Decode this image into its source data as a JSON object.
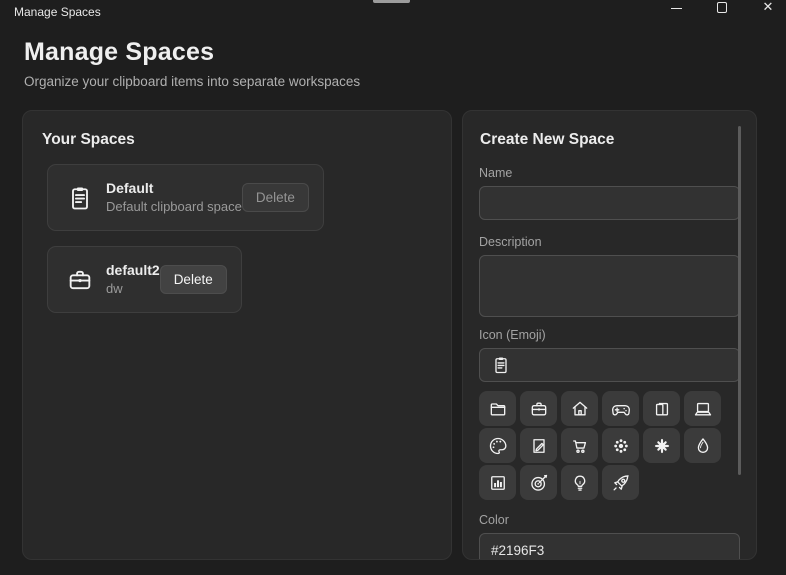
{
  "window": {
    "title": "Manage Spaces",
    "close_glyph": "✕"
  },
  "header": {
    "title": "Manage Spaces",
    "subtitle": "Organize your clipboard items into separate workspaces"
  },
  "spaces_panel": {
    "title": "Your Spaces",
    "items": [
      {
        "icon": "clipboard-icon",
        "name": "Default",
        "description": "Default clipboard space",
        "delete_label": "Delete",
        "delete_disabled": true
      },
      {
        "icon": "briefcase-icon",
        "name": "default2",
        "description": "dw",
        "delete_label": "Delete",
        "delete_disabled": false
      }
    ]
  },
  "create_panel": {
    "title": "Create New Space",
    "fields": {
      "name": {
        "label": "Name",
        "value": ""
      },
      "description": {
        "label": "Description",
        "value": ""
      },
      "icon": {
        "label": "Icon (Emoji)",
        "value": "clipboard-icon"
      },
      "color": {
        "label": "Color",
        "value": "#2196F3"
      }
    },
    "emoji_options": [
      "folder-icon",
      "briefcase-icon",
      "house-icon",
      "gamepad-icon",
      "books-icon",
      "laptop-icon",
      "palette-icon",
      "memo-icon",
      "cart-icon",
      "gear-icon",
      "sparkle-icon",
      "droplet-icon",
      "chart-icon",
      "target-icon",
      "bulb-icon",
      "rocket-icon"
    ]
  },
  "colors": {
    "accent": "#2196F3",
    "background": "#1e1e1e",
    "panel": "#282828"
  }
}
